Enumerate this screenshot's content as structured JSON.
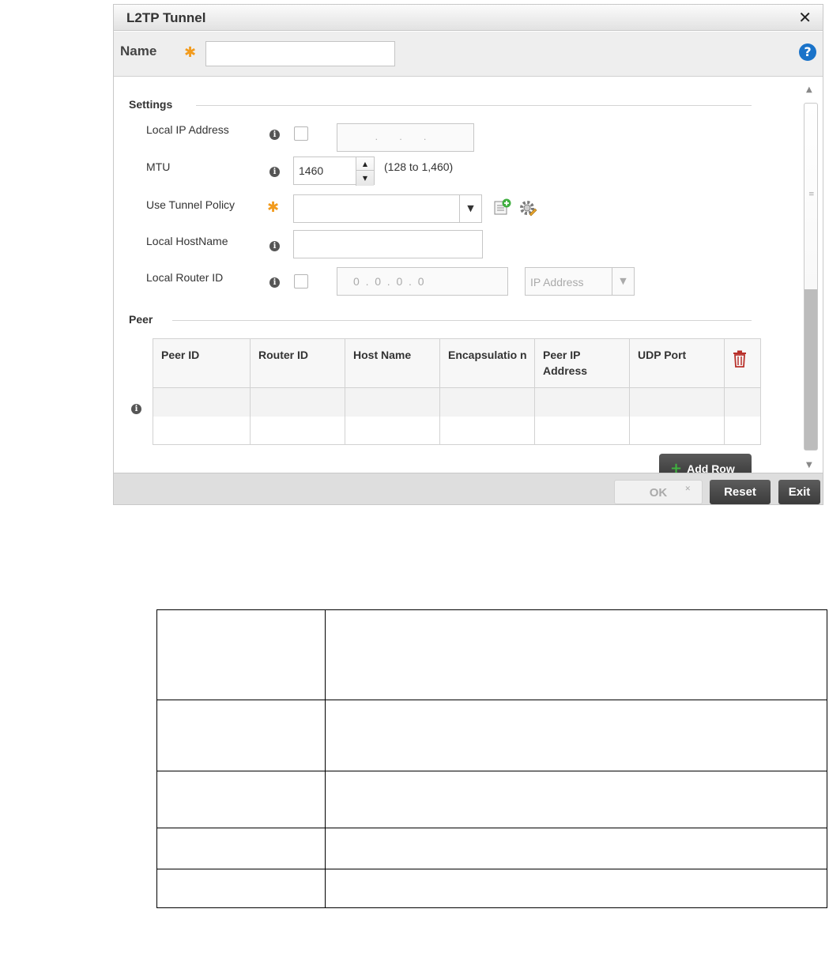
{
  "dialog": {
    "title": "L2TP Tunnel",
    "close_glyph": "✕",
    "name_label": "Name",
    "required_glyph": "✱",
    "name_value": "",
    "help_glyph": "?"
  },
  "settings": {
    "section_title": "Settings",
    "local_ip": {
      "label": "Local IP Address",
      "checked": false,
      "value": ". . ."
    },
    "mtu": {
      "label": "MTU",
      "value": "1460",
      "range": "(128 to 1,460)"
    },
    "tunnel_policy": {
      "label": "Use Tunnel Policy",
      "value": ""
    },
    "local_hostname": {
      "label": "Local HostName",
      "value": ""
    },
    "local_router_id": {
      "label": "Local Router ID",
      "checked": false,
      "value": "0  .  0  .  0  .  0",
      "type_value": "IP Address"
    }
  },
  "peer": {
    "section_title": "Peer",
    "columns": [
      "Peer ID",
      "Router ID",
      "Host Name",
      "Encapsulatio n",
      "Peer IP Address",
      "UDP Port"
    ],
    "rows": [],
    "add_row_label": "Add Row"
  },
  "footer": {
    "ok_label": "OK",
    "reset_label": "Reset",
    "exit_label": "Exit"
  },
  "icons": {
    "info": "info-icon",
    "trash": "trash-icon",
    "create": "create-policy-icon",
    "edit": "edit-policy-icon"
  },
  "colors": {
    "required_star": "#f29b1d",
    "help": "#1a73c9",
    "add_plus": "#3fb43f",
    "trash": "#c0392b"
  },
  "doc_table": {
    "rows": [
      [
        "",
        ""
      ],
      [
        "",
        ""
      ],
      [
        "",
        ""
      ],
      [
        "",
        ""
      ],
      [
        "",
        ""
      ]
    ]
  }
}
